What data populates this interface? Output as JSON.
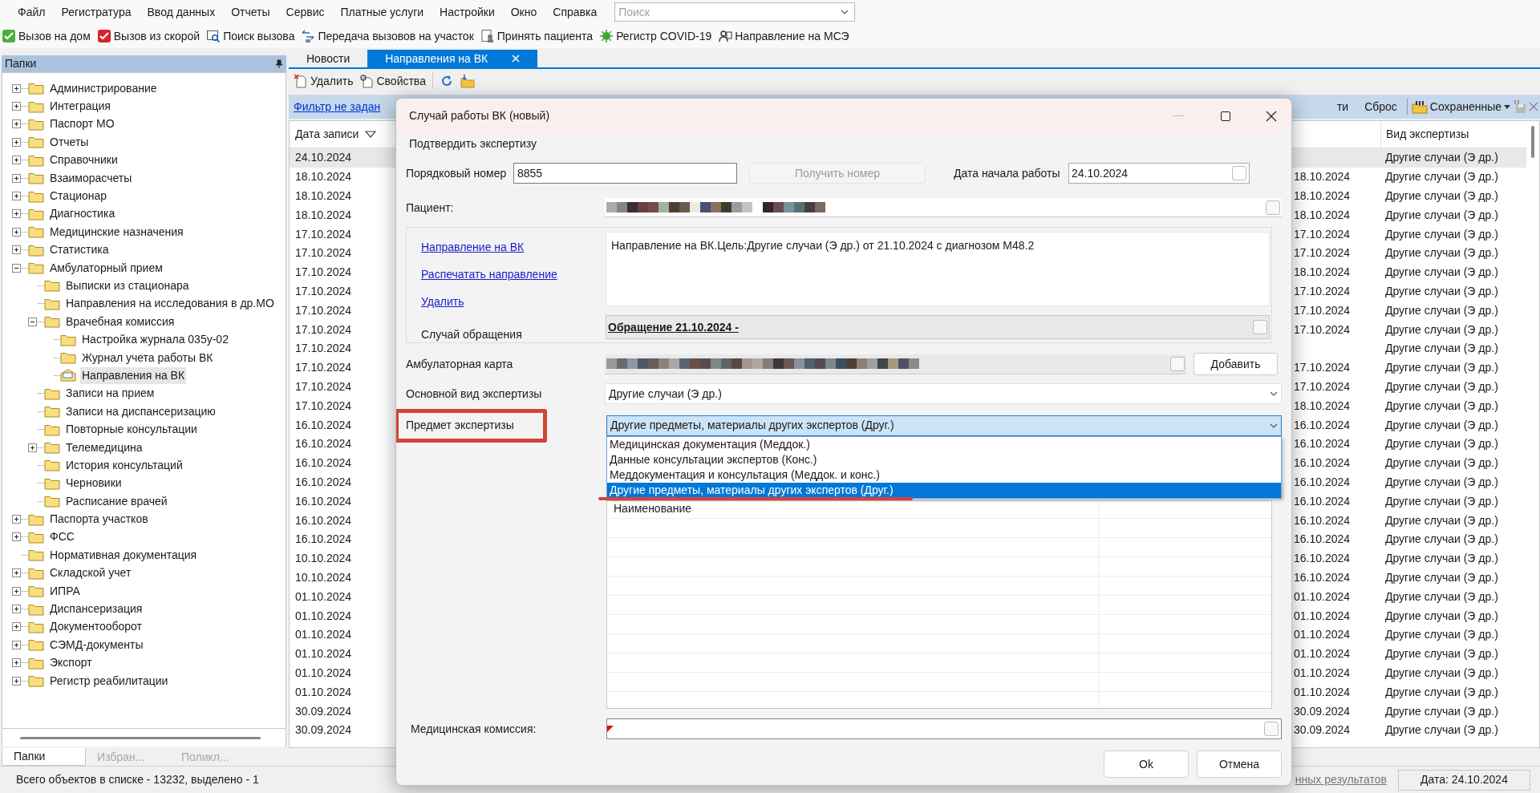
{
  "menu_bar": {
    "items": [
      "Файл",
      "Регистратура",
      "Ввод данных",
      "Отчеты",
      "Сервис",
      "Платные услуги",
      "Настройки",
      "Окно",
      "Справка"
    ],
    "search": {
      "placeholder": "Поиск"
    }
  },
  "toolbar": [
    "Вызов на дом",
    "Вызов из скорой",
    "Поиск вызова",
    "Передача вызовов на участок",
    "Принять пациента",
    "Регистр COVID-19",
    "Направление на МСЭ"
  ],
  "folders_panel": {
    "title": "Папки",
    "tree": [
      {
        "label": "Администрирование",
        "expanded": false,
        "selected": false
      },
      {
        "label": "Интеграция",
        "expanded": false,
        "selected": false
      },
      {
        "label": "Паспорт МО",
        "expanded": false,
        "selected": false
      },
      {
        "label": "Отчеты",
        "expanded": false,
        "selected": false
      },
      {
        "label": "Справочники",
        "expanded": false,
        "selected": false
      },
      {
        "label": "Взаиморасчеты",
        "expanded": false,
        "selected": false
      },
      {
        "label": "Стационар",
        "expanded": false,
        "selected": false
      },
      {
        "label": "Диагностика",
        "expanded": false,
        "selected": false
      },
      {
        "label": "Медицинские назначения",
        "expanded": false,
        "selected": false
      },
      {
        "label": "Статистика",
        "expanded": false,
        "selected": false
      },
      {
        "label": "Амбулаторный прием",
        "expanded": true,
        "selected": false,
        "children": [
          {
            "label": "Выписки из стационара",
            "selected": false
          },
          {
            "label": "Направления на исследования в др.МО",
            "selected": false
          },
          {
            "label": "Врачебная комиссия",
            "expanded": true,
            "selected": false,
            "children": [
              {
                "label": "Настройка журнала 035у-02",
                "selected": false
              },
              {
                "label": "Журнал учета работы ВК",
                "selected": false
              },
              {
                "label": "Направления на ВК",
                "selected": true
              }
            ]
          },
          {
            "label": "Записи на прием",
            "selected": false
          },
          {
            "label": "Записи на диспансеризацию",
            "selected": false
          },
          {
            "label": "Повторные консультации",
            "selected": false
          },
          {
            "label": "Телемедицина",
            "expanded": false,
            "selected": false
          },
          {
            "label": "История консультаций",
            "selected": false
          },
          {
            "label": "Черновики",
            "selected": false
          },
          {
            "label": "Расписание врачей",
            "selected": false
          }
        ]
      },
      {
        "label": "Паспорта участков",
        "expanded": false,
        "selected": false
      },
      {
        "label": "ФСС",
        "expanded": false,
        "selected": false
      },
      {
        "label": "Нормативная документация",
        "selected": false
      },
      {
        "label": "Складской учет",
        "expanded": false,
        "selected": false
      },
      {
        "label": "ИПРА",
        "expanded": false,
        "selected": false
      },
      {
        "label": "Диспансеризация",
        "expanded": false,
        "selected": false
      },
      {
        "label": "Документооборот",
        "expanded": false,
        "selected": false
      },
      {
        "label": "СЭМД-документы",
        "expanded": false,
        "selected": false
      },
      {
        "label": "Экспорт",
        "expanded": false,
        "selected": false
      },
      {
        "label": "Регистр реабилитации",
        "expanded": false,
        "selected": false
      }
    ],
    "tabs": [
      {
        "label": "Папки",
        "selected": true
      },
      {
        "label": "Избран...",
        "selected": false
      },
      {
        "label": "Поликл...",
        "selected": false
      }
    ]
  },
  "document_tabs": [
    {
      "label": "Новости",
      "selected": false
    },
    {
      "label": "Направления на ВК",
      "selected": true
    }
  ],
  "list_toolbar": [
    "Удалить",
    "Свойства"
  ],
  "filter_bar": {
    "filter_link": "Фильтр не задан",
    "buttons": [
      "ти",
      "Сброс"
    ],
    "saved": "Сохраненные"
  },
  "table": {
    "columns": {
      "date": "Дата записи",
      "expertise": "Вид экспертизы"
    },
    "rows": [
      {
        "date": "24.10.2024",
        "expertise": "Другие случаи (Э др.)",
        "selected": true
      },
      {
        "date": "18.10.2024",
        "column_2": "18.10.2024",
        "expertise": "Другие случаи (Э др.)",
        "selected": false
      },
      {
        "date": "18.10.2024",
        "column_2": "18.10.2024",
        "expertise": "Другие случаи (Э др.)",
        "selected": false
      },
      {
        "date": "18.10.2024",
        "column_2": "18.10.2024",
        "expertise": "Другие случаи (Э др.)",
        "selected": false
      },
      {
        "date": "17.10.2024",
        "column_2": "17.10.2024",
        "expertise": "Другие случаи (Э др.)",
        "selected": false
      },
      {
        "date": "17.10.2024",
        "column_2": "17.10.2024",
        "expertise": "Другие случаи (Э др.)",
        "selected": false
      },
      {
        "date": "17.10.2024",
        "column_2": "18.10.2024",
        "expertise": "Другие случаи (Э др.)",
        "selected": false
      },
      {
        "date": "17.10.2024",
        "column_2": "17.10.2024",
        "expertise": "Другие случаи (Э др.)",
        "selected": false
      },
      {
        "date": "17.10.2024",
        "column_2": "17.10.2024",
        "expertise": "Другие случаи (Э др.)",
        "selected": false
      },
      {
        "date": "17.10.2024",
        "column_2": "17.10.2024",
        "expertise": "Другие случаи (Э др.)",
        "selected": false
      },
      {
        "date": "17.10.2024",
        "expertise": "Другие случаи (Э др.)",
        "selected": false
      },
      {
        "date": "17.10.2024",
        "column_2": "17.10.2024",
        "expertise": "Другие случаи (Э др.)",
        "selected": false
      },
      {
        "date": "17.10.2024",
        "column_2": "17.10.2024",
        "expertise": "Другие случаи (Э др.)",
        "selected": false
      },
      {
        "date": "17.10.2024",
        "column_2": "18.10.2024",
        "expertise": "Другие случаи (Э др.)",
        "selected": false
      },
      {
        "date": "16.10.2024",
        "column_2": "16.10.2024",
        "expertise": "Другие случаи (Э др.)",
        "selected": false
      },
      {
        "date": "16.10.2024",
        "column_2": "16.10.2024",
        "expertise": "Другие случаи (Э др.)",
        "selected": false
      },
      {
        "date": "16.10.2024",
        "column_2": "16.10.2024",
        "expertise": "Другие случаи (Э др.)",
        "selected": false
      },
      {
        "date": "16.10.2024",
        "column_2": "16.10.2024",
        "expertise": "Другие случаи (Э др.)",
        "selected": false
      },
      {
        "date": "16.10.2024",
        "column_2": "16.10.2024",
        "expertise": "Другие случаи (Э др.)",
        "selected": false
      },
      {
        "date": "16.10.2024",
        "column_2": "16.10.2024",
        "expertise": "Другие случаи (Э др.)",
        "selected": false
      },
      {
        "date": "16.10.2024",
        "column_2": "16.10.2024",
        "expertise": "Другие случаи (Э др.)",
        "selected": false
      },
      {
        "date": "10.10.2024",
        "column_2": "16.10.2024",
        "expertise": "Другие случаи (Э др.)",
        "selected": false
      },
      {
        "date": "10.10.2024",
        "column_2": "16.10.2024",
        "expertise": "Другие случаи (Э др.)",
        "selected": false
      },
      {
        "date": "01.10.2024",
        "column_2": "01.10.2024",
        "expertise": "Другие случаи (Э др.)",
        "selected": false
      },
      {
        "date": "01.10.2024",
        "column_2": "01.10.2024",
        "expertise": "Другие случаи (Э др.)",
        "selected": false
      },
      {
        "date": "01.10.2024",
        "column_2": "01.10.2024",
        "expertise": "Другие случаи (Э др.)",
        "selected": false
      },
      {
        "date": "01.10.2024",
        "column_2": "01.10.2024",
        "expertise": "Другие случаи (Э др.)",
        "selected": false
      },
      {
        "date": "01.10.2024",
        "column_2": "01.10.2024",
        "expertise": "Другие случаи (Э др.)",
        "selected": false
      },
      {
        "date": "01.10.2024",
        "column_2": "01.10.2024",
        "expertise": "Другие случаи (Э др.)",
        "selected": false
      },
      {
        "date": "30.09.2024",
        "column_2": "30.09.2024",
        "expertise": "Другие случаи (Э др.)",
        "selected": false
      },
      {
        "date": "30.09.2024",
        "column_2": "30.09.2024",
        "expertise": "Другие случаи (Э др.)",
        "selected": false
      }
    ]
  },
  "status_bar": {
    "count": "Всего объектов в списке - 13232, выделено - 1",
    "results_link": "нных результатов",
    "date": "Дата: 24.10.2024"
  },
  "dialog": {
    "title": "Случай работы ВК (новый)",
    "menu": [
      "Подтвердить экспертизу"
    ],
    "number": {
      "label": "Порядковый номер",
      "value": "8855"
    },
    "get_number_button": {
      "label": "Получить номер",
      "disabled": true
    },
    "start_date": {
      "label": "Дата начала работы",
      "value": "24.10.2024"
    },
    "patient": {
      "label": "Пациент:"
    },
    "links": [
      "Направление на ВК",
      "Распечатать направление",
      "Удалить"
    ],
    "referral_text": "Направление на ВК.Цель:Другие случаи (Э др.) от 21.10.2024 с диагнозом M48.2",
    "case": {
      "label": "Случай обращения",
      "value": "Обращение 21.10.2024 -"
    },
    "card": {
      "label": "Амбулаторная карта",
      "button": "Добавить"
    },
    "expertise_type": {
      "label": "Основной вид экспертизы",
      "value": "Другие случаи (Э др.)"
    },
    "subject": {
      "label": "Предмет экспертизы",
      "value": "Другие предметы, материалы других экспертов (Друг.)",
      "options": [
        {
          "label": "Медицинская документация (Меддок.)",
          "selected": false
        },
        {
          "label": "Данные консультации экспертов (Конс.)",
          "selected": false
        },
        {
          "label": "Меддокументация и консультация (Меддок. и конс.)",
          "selected": false
        },
        {
          "label": "Другие предметы, материалы других экспертов (Друг.)",
          "selected": true
        }
      ]
    },
    "grid": {
      "columns": [
        "Наименование"
      ]
    },
    "commission": {
      "label": "Медицинская комиссия:"
    },
    "buttons": [
      "Ok",
      "Отмена"
    ]
  }
}
